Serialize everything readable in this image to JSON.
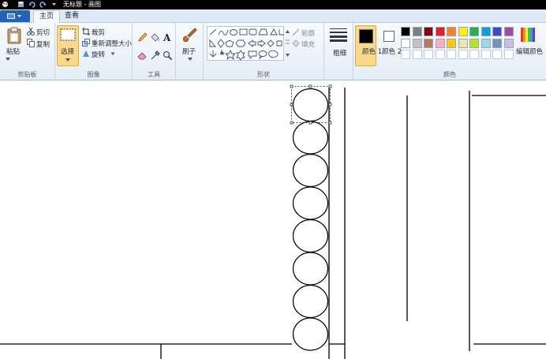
{
  "window": {
    "title": "无标题 - 画图"
  },
  "tabs": [
    {
      "label": "主页",
      "active": true
    },
    {
      "label": "查看",
      "active": false
    }
  ],
  "ribbon": {
    "clipboard": {
      "paste": "粘贴",
      "cut": "剪切",
      "copy": "复制",
      "group": "剪贴板"
    },
    "image": {
      "select": "选择",
      "crop": "裁剪",
      "resize": "重新调整大小",
      "rotate": "旋转",
      "group": "图像"
    },
    "tools": {
      "group": "工具"
    },
    "brushes": {
      "label": "刷子"
    },
    "shapes": {
      "outline": "轮廓",
      "fill": "填充",
      "group": "形状"
    },
    "size": {
      "label": "粗细"
    },
    "colors": {
      "color1": "颜色 1",
      "color2": "颜色 2",
      "edit": "编辑颜色",
      "group": "颜色",
      "color1_value": "#000000",
      "color2_value": "#ffffff",
      "row1": [
        "#000000",
        "#7f7f7f",
        "#880015",
        "#ed1c24",
        "#ff7f27",
        "#fff200",
        "#22b14c",
        "#00a2e8",
        "#3f48cc",
        "#a349a4"
      ],
      "row2": [
        "#ffffff",
        "#c3c3c3",
        "#b97a57",
        "#ffaec9",
        "#ffc90e",
        "#efe4b0",
        "#b5e61d",
        "#99d9ea",
        "#7092be",
        "#c8bfe7"
      ]
    }
  },
  "canvas": {
    "circle_count": 8
  }
}
